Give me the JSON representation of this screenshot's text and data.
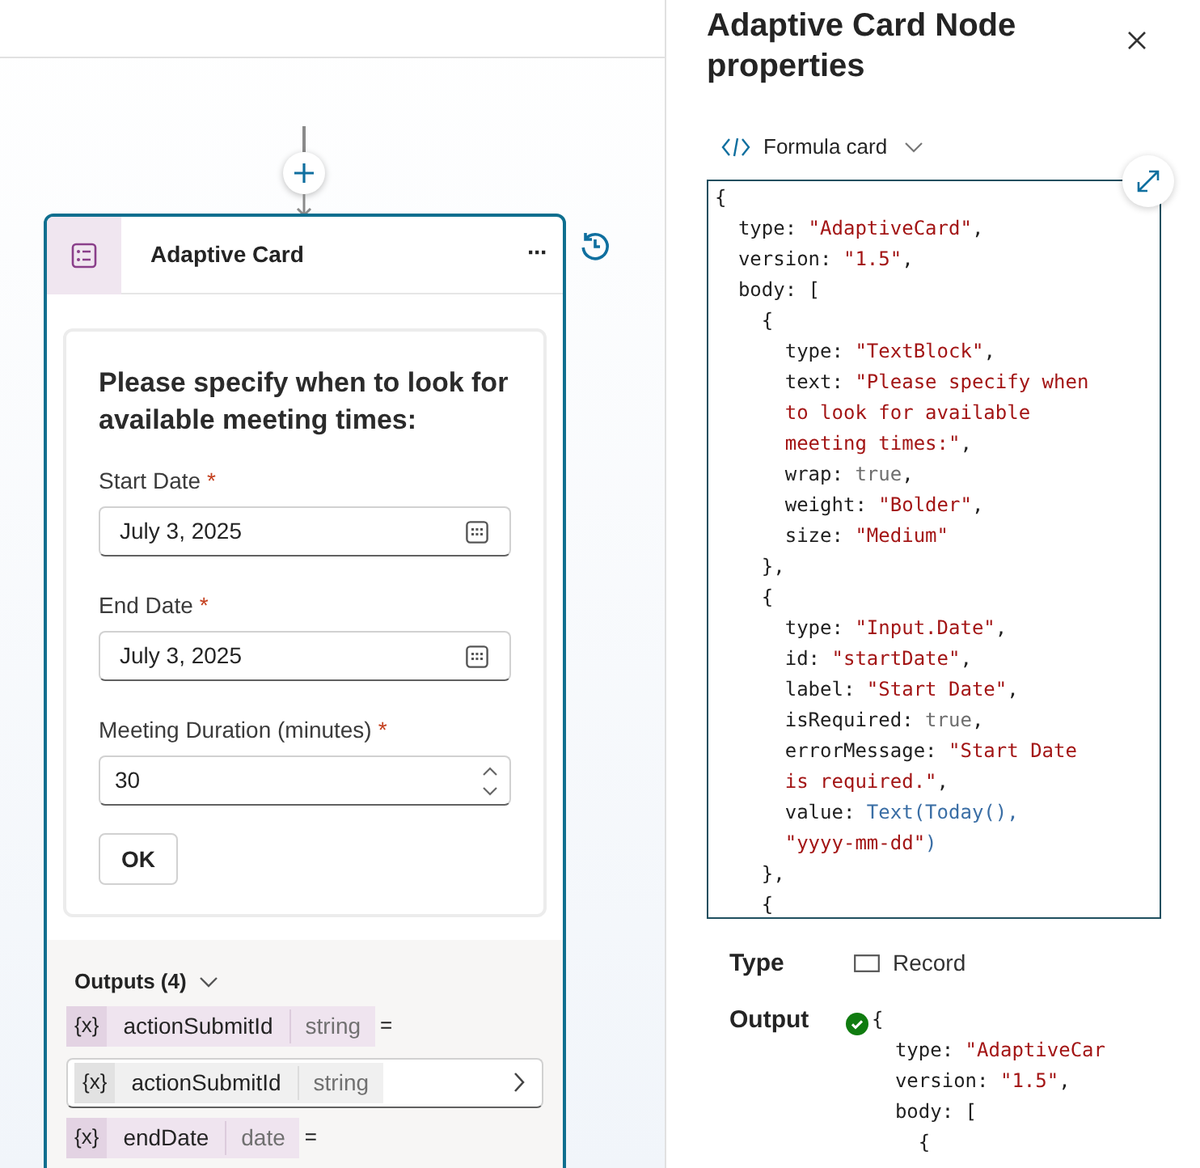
{
  "canvas": {
    "node": {
      "title": "Adaptive Card",
      "menu": "···"
    },
    "form": {
      "heading": "Please specify when to look for available meeting times:",
      "fields": [
        {
          "kind": "date",
          "label": "Start Date",
          "required_mark": "*",
          "value": "July 3, 2025"
        },
        {
          "kind": "date",
          "label": "End Date",
          "required_mark": "*",
          "value": "July 3, 2025"
        },
        {
          "kind": "number",
          "label": "Meeting Duration (minutes)",
          "required_mark": "*",
          "value": "30"
        }
      ],
      "submit": "OK"
    },
    "outputs": {
      "title": "Outputs (4)",
      "expanded": true,
      "items": [
        {
          "kind": "assign",
          "token": "{x}",
          "name": "actionSubmitId",
          "type": "string",
          "sign": "="
        },
        {
          "kind": "value",
          "token": "{x}",
          "name": "actionSubmitId",
          "type": "string"
        },
        {
          "kind": "assign",
          "token": "{x}",
          "name": "endDate",
          "type": "date",
          "sign": "="
        }
      ]
    }
  },
  "panel": {
    "title": "Adaptive Card Node properties",
    "mode": "Formula card",
    "code": [
      [
        {
          "kind": "punct",
          "text": "{"
        }
      ],
      [
        {
          "kind": "key",
          "text": "  type: "
        },
        {
          "kind": "string",
          "text": "\"AdaptiveCard\""
        },
        {
          "kind": "punct",
          "text": ","
        }
      ],
      [
        {
          "kind": "key",
          "text": "  version: "
        },
        {
          "kind": "string",
          "text": "\"1.5\""
        },
        {
          "kind": "punct",
          "text": ","
        }
      ],
      [
        {
          "kind": "key",
          "text": "  body: ["
        }
      ],
      [
        {
          "kind": "punct",
          "text": "    {"
        }
      ],
      [
        {
          "kind": "key",
          "text": "      type: "
        },
        {
          "kind": "string",
          "text": "\"TextBlock\""
        },
        {
          "kind": "punct",
          "text": ","
        }
      ],
      [
        {
          "kind": "key",
          "text": "      text: "
        },
        {
          "kind": "string",
          "text": "\"Please specify when"
        }
      ],
      [
        {
          "kind": "string",
          "text": "      to look for available"
        }
      ],
      [
        {
          "kind": "string",
          "text": "      meeting times:\""
        },
        {
          "kind": "punct",
          "text": ","
        }
      ],
      [
        {
          "kind": "key",
          "text": "      wrap: "
        },
        {
          "kind": "bool",
          "text": "true"
        },
        {
          "kind": "punct",
          "text": ","
        }
      ],
      [
        {
          "kind": "key",
          "text": "      weight: "
        },
        {
          "kind": "string",
          "text": "\"Bolder\""
        },
        {
          "kind": "punct",
          "text": ","
        }
      ],
      [
        {
          "kind": "key",
          "text": "      size: "
        },
        {
          "kind": "string",
          "text": "\"Medium\""
        }
      ],
      [
        {
          "kind": "punct",
          "text": "    },"
        }
      ],
      [
        {
          "kind": "punct",
          "text": "    {"
        }
      ],
      [
        {
          "kind": "key",
          "text": "      type: "
        },
        {
          "kind": "string",
          "text": "\"Input.Date\""
        },
        {
          "kind": "punct",
          "text": ","
        }
      ],
      [
        {
          "kind": "key",
          "text": "      id: "
        },
        {
          "kind": "string",
          "text": "\"startDate\""
        },
        {
          "kind": "punct",
          "text": ","
        }
      ],
      [
        {
          "kind": "key",
          "text": "      label: "
        },
        {
          "kind": "string",
          "text": "\"Start Date\""
        },
        {
          "kind": "punct",
          "text": ","
        }
      ],
      [
        {
          "kind": "key",
          "text": "      isRequired: "
        },
        {
          "kind": "bool",
          "text": "true"
        },
        {
          "kind": "punct",
          "text": ","
        }
      ],
      [
        {
          "kind": "key",
          "text": "      errorMessage: "
        },
        {
          "kind": "string",
          "text": "\"Start Date"
        }
      ],
      [
        {
          "kind": "string",
          "text": "      is required.\""
        },
        {
          "kind": "punct",
          "text": ","
        }
      ],
      [
        {
          "kind": "key",
          "text": "      value: "
        },
        {
          "kind": "func",
          "text": "Text(Today(),"
        }
      ],
      [
        {
          "kind": "string",
          "text": "      \"yyyy-mm-dd\""
        },
        {
          "kind": "func",
          "text": ")"
        }
      ],
      [
        {
          "kind": "punct",
          "text": "    },"
        }
      ],
      [
        {
          "kind": "punct",
          "text": "    {"
        }
      ]
    ],
    "type_label": "Type",
    "type_value": "Record",
    "output_label": "Output",
    "output_valid": true,
    "output_code": [
      [
        {
          "kind": "punct",
          "text": "{"
        }
      ],
      [
        {
          "kind": "key",
          "text": "  type: "
        },
        {
          "kind": "string",
          "text": "\"AdaptiveCar"
        }
      ],
      [
        {
          "kind": "key",
          "text": "  version: "
        },
        {
          "kind": "string",
          "text": "\"1.5\""
        },
        {
          "kind": "punct",
          "text": ","
        }
      ],
      [
        {
          "kind": "key",
          "text": "  body: ["
        }
      ],
      [
        {
          "kind": "punct",
          "text": "    {"
        }
      ]
    ]
  }
}
